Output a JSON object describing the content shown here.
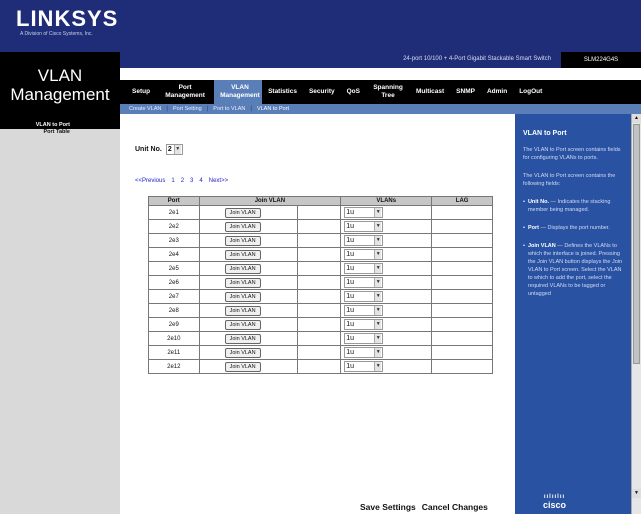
{
  "brand": {
    "logo": "LINKSYS",
    "subtitle": "A Division of Cisco Systems, Inc."
  },
  "section": {
    "title_line1": "VLAN",
    "title_line2": "Management"
  },
  "product": {
    "name": "24-port 10/100 + 4-Port Gigabit Stackable Smart Switch",
    "model": "SLM224G4S"
  },
  "nav": {
    "tabs": [
      {
        "label": "Setup"
      },
      {
        "label": "Port Management"
      },
      {
        "label": "VLAN Management"
      },
      {
        "label": "Statistics"
      },
      {
        "label": "Security"
      },
      {
        "label": "QoS"
      },
      {
        "label": "Spanning Tree"
      },
      {
        "label": "Multicast"
      },
      {
        "label": "SNMP"
      },
      {
        "label": "Admin"
      },
      {
        "label": "LogOut"
      }
    ],
    "subtabs": [
      {
        "label": "Create VLAN"
      },
      {
        "label": "Port Setting"
      },
      {
        "label": "Port to VLAN"
      },
      {
        "label": "VLAN to Port"
      }
    ]
  },
  "sidebar": {
    "items": [
      {
        "label": "VLAN to Port"
      },
      {
        "label": "Port Table"
      }
    ]
  },
  "unit": {
    "label": "Unit No.",
    "value": "2"
  },
  "pager": {
    "previous": "<<Previous",
    "pages": [
      "1",
      "2",
      "3",
      "4"
    ],
    "next": "Next>>"
  },
  "table": {
    "headers": [
      "Port",
      "Join VLAN",
      "VLANs",
      "LAG"
    ],
    "join_label": "Join VLAN",
    "vlans_value": "1u",
    "rows": [
      {
        "port": "2e1"
      },
      {
        "port": "2e2"
      },
      {
        "port": "2e3"
      },
      {
        "port": "2e4"
      },
      {
        "port": "2e5"
      },
      {
        "port": "2e6"
      },
      {
        "port": "2e7"
      },
      {
        "port": "2e8"
      },
      {
        "port": "2e9"
      },
      {
        "port": "2e10"
      },
      {
        "port": "2e11"
      },
      {
        "port": "2e12"
      }
    ]
  },
  "actions": {
    "save": "Save Settings",
    "cancel": "Cancel Changes"
  },
  "help": {
    "title": "VLAN to Port",
    "para1": "The VLAN to Port screen contains fields for configuring VLANs to ports.",
    "para2": "The VLAN to Port screen contains the following fields:",
    "bullets": [
      {
        "term": "Unit No.",
        "text": "Indicates the stacking member being managed."
      },
      {
        "term": "Port",
        "text": "Displays the port number."
      },
      {
        "term": "Join VLAN",
        "text": "Defines the VLANs to which the interface is joined. Pressing the Join VLAN button displays the Join VLAN to Port screen. Select the VLAN to which to add the port, select the required VLANs to be tagged or untagged"
      }
    ],
    "vendor": "cisco"
  },
  "colors": {
    "header_blue": "#1f2d78",
    "help_blue": "#2952a3",
    "subnav_blue": "#5a7fb8"
  }
}
